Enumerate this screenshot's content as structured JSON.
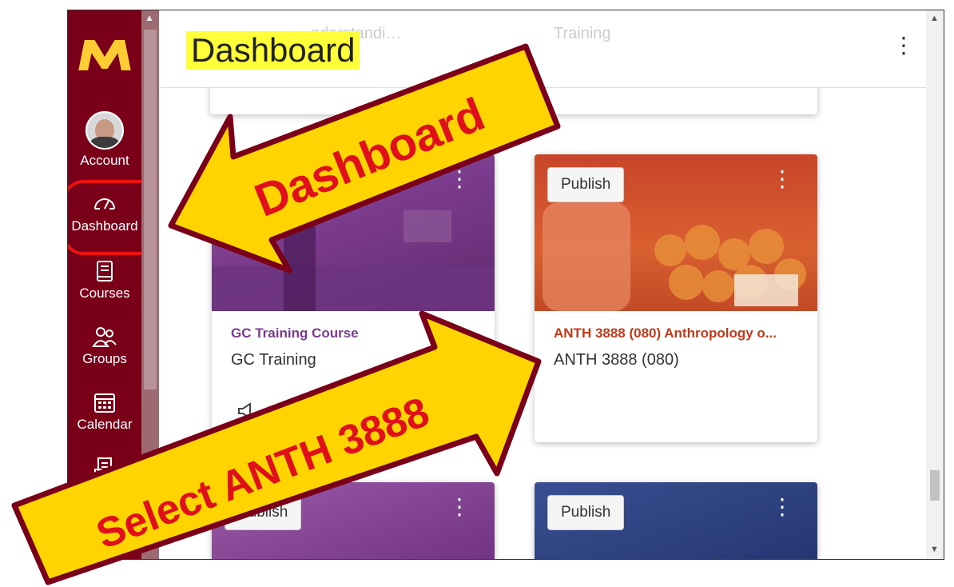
{
  "colors": {
    "sidebar": "#7a0019",
    "gold": "#ffcc33",
    "highlight_red": "#e11111",
    "callout_yellow": "#ffd400",
    "purple_card": "#8a3b96",
    "orange_card": "#d8542a",
    "blue_card": "#2c3d7c"
  },
  "sidebar": {
    "items": [
      {
        "label": "Account",
        "icon": "avatar"
      },
      {
        "label": "Dashboard",
        "icon": "dashboard-gauge-icon"
      },
      {
        "label": "Courses",
        "icon": "book-icon"
      },
      {
        "label": "Groups",
        "icon": "people-icon"
      },
      {
        "label": "Calendar",
        "icon": "calendar-icon"
      },
      {
        "label": "",
        "icon": "inbox-icon"
      }
    ]
  },
  "header": {
    "title": "Dashboard",
    "faded_left": "…nderstandi…",
    "faded_right": "Training"
  },
  "cards": [
    {
      "course_name": "GC Training Course",
      "course_code": "GC Training",
      "publish_label": "",
      "color": "#8a3b96"
    },
    {
      "course_name": "ANTH 3888 (080) Anthropology o...",
      "course_code": "ANTH 3888 (080)",
      "publish_label": "Publish",
      "color": "#d8542a"
    },
    {
      "course_name": "",
      "course_code": "",
      "publish_label": "Publish",
      "color": "#8a3b96"
    },
    {
      "course_name": "",
      "course_code": "",
      "publish_label": "Publish",
      "color": "#2c3d7c"
    }
  ],
  "callouts": {
    "dashboard_arrow_text": "Dashboard",
    "select_arrow_text": "Select ANTH 3888"
  }
}
